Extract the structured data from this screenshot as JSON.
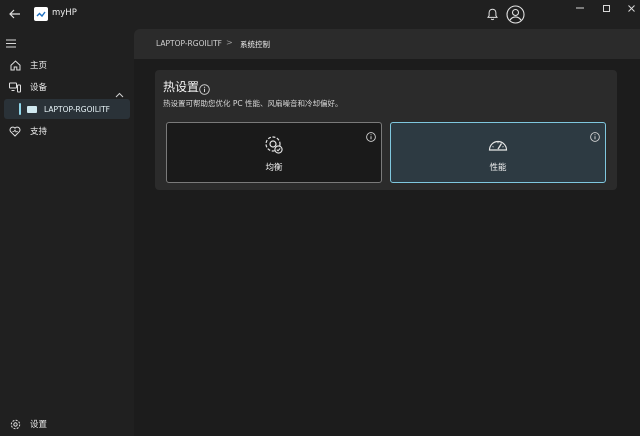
{
  "app": {
    "title": "myHP"
  },
  "sidebar": {
    "items": [
      {
        "label": "主页"
      },
      {
        "label": "设备"
      },
      {
        "label": "LAPTOP-RGOILITF"
      },
      {
        "label": "支持"
      }
    ],
    "settings_label": "设置"
  },
  "breadcrumb": {
    "device": "LAPTOP-RGOILITF",
    "separator": ">",
    "page": "系统控制"
  },
  "thermal": {
    "title": "热设置",
    "description": "热设置可帮助您优化 PC 性能、风扇噪音和冷却偏好。",
    "modes": [
      {
        "label": "均衡",
        "selected": false
      },
      {
        "label": "性能",
        "selected": true
      }
    ]
  },
  "colors": {
    "accent": "#7fc7de",
    "background": "#202020",
    "panel": "#2b2b2b"
  }
}
